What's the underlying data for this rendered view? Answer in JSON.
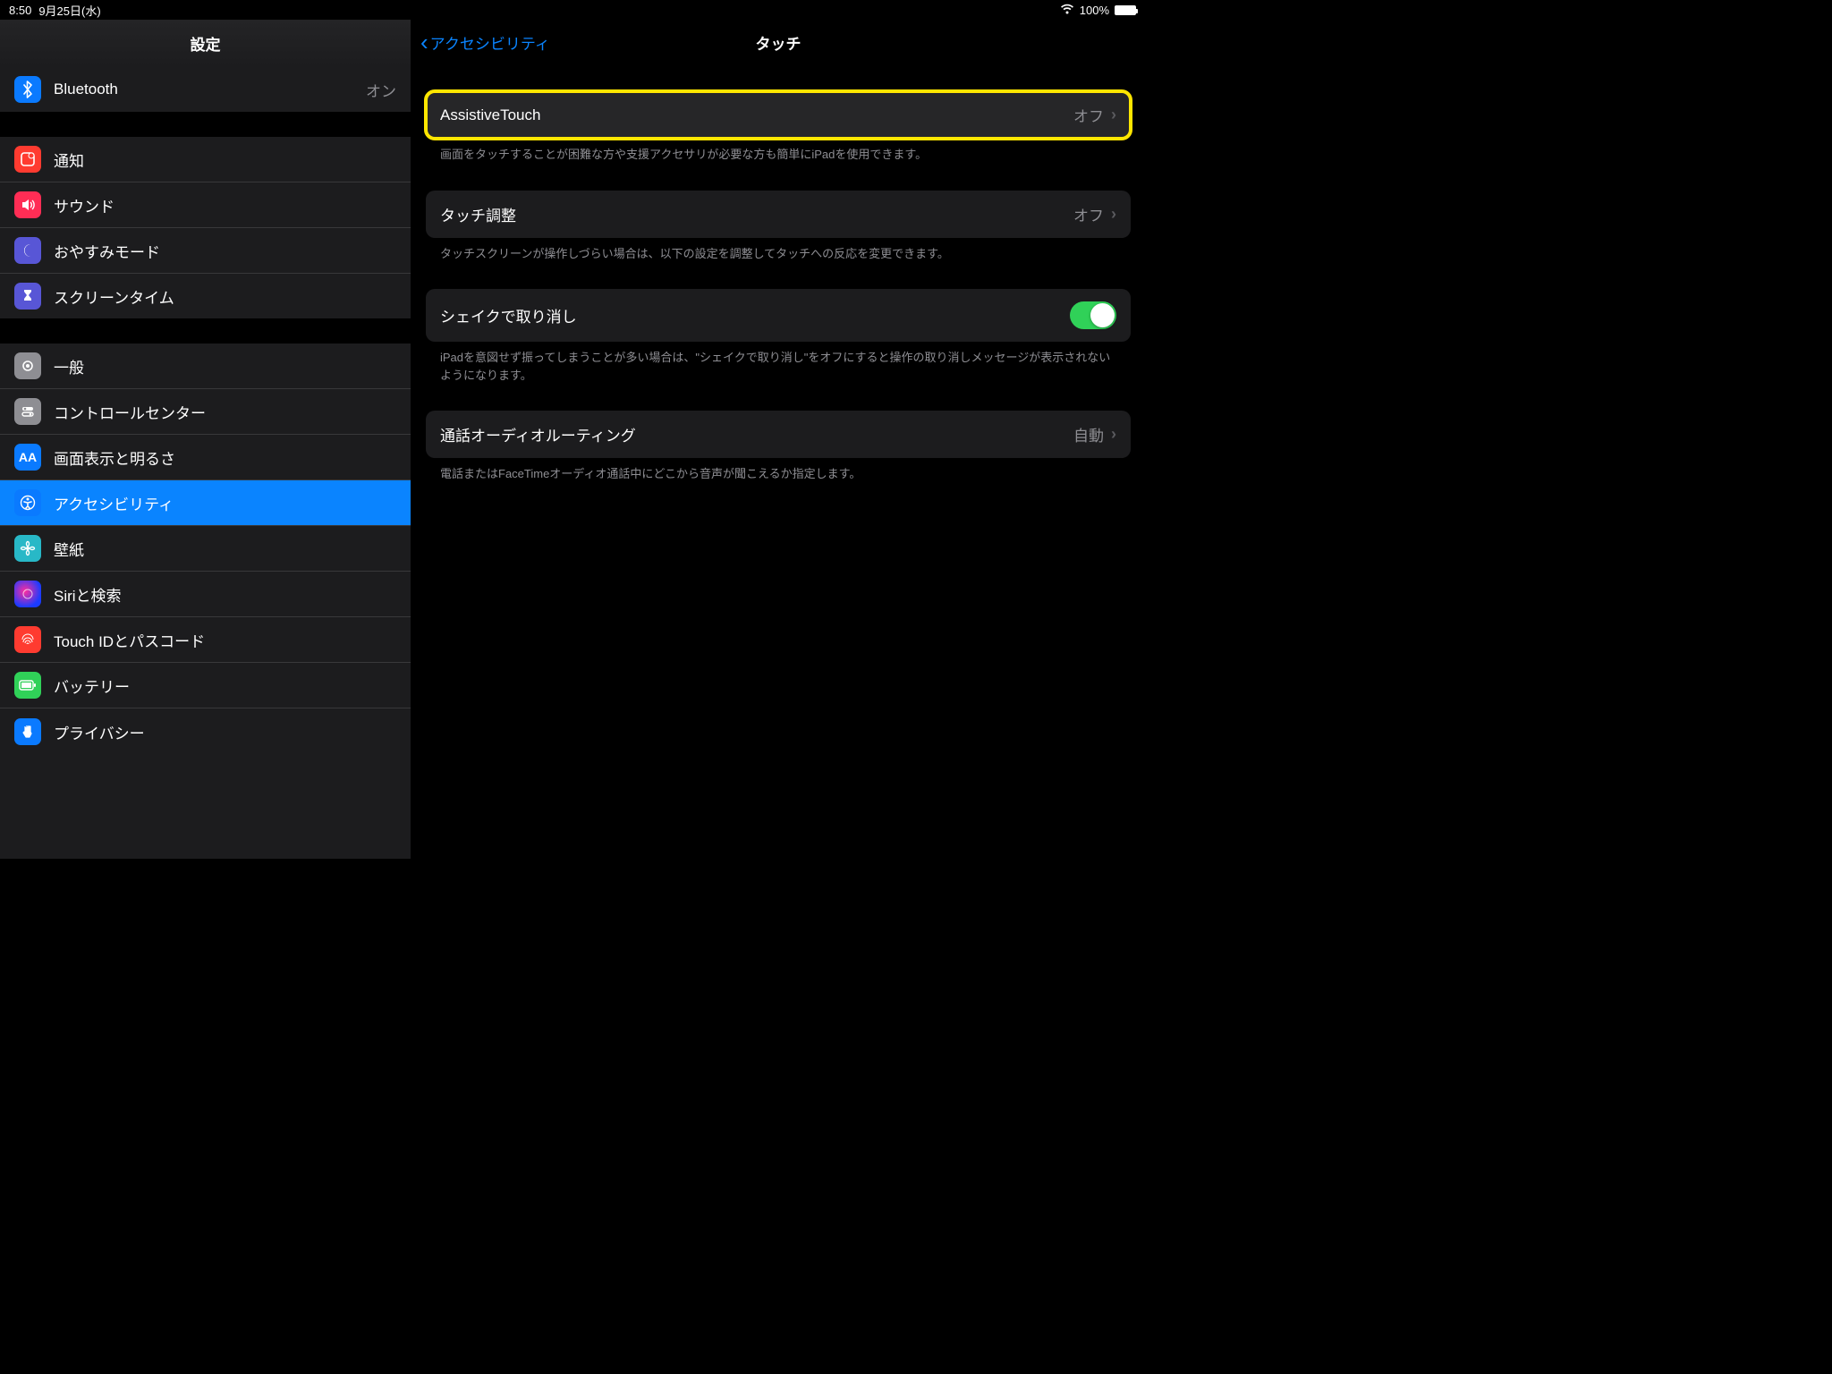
{
  "status": {
    "time": "8:50",
    "date": "9月25日(水)",
    "battery": "100%"
  },
  "sidebar": {
    "title": "設定",
    "bluetoothLabel": "Bluetooth",
    "bluetoothValue": "オン",
    "notifications": "通知",
    "sound": "サウンド",
    "dnd": "おやすみモード",
    "screentime": "スクリーンタイム",
    "general": "一般",
    "controlcenter": "コントロールセンター",
    "display": "画面表示と明るさ",
    "accessibility": "アクセシビリティ",
    "wallpaper": "壁紙",
    "siri": "Siriと検索",
    "touchid": "Touch IDとパスコード",
    "battery": "バッテリー",
    "privacy": "プライバシー"
  },
  "detail": {
    "backLabel": "アクセシビリティ",
    "title": "タッチ",
    "rows": {
      "assistive": {
        "label": "AssistiveTouch",
        "value": "オフ"
      },
      "assistiveFooter": "画面をタッチすることが困難な方や支援アクセサリが必要な方も簡単にiPadを使用できます。",
      "touchAdj": {
        "label": "タッチ調整",
        "value": "オフ"
      },
      "touchAdjFooter": "タッチスクリーンが操作しづらい場合は、以下の設定を調整してタッチへの反応を変更できます。",
      "shake": {
        "label": "シェイクで取り消し"
      },
      "shakeFooter": "iPadを意図せず振ってしまうことが多い場合は、\"シェイクで取り消し\"をオフにすると操作の取り消しメッセージが表示されないようになります。",
      "audio": {
        "label": "通話オーディオルーティング",
        "value": "自動"
      },
      "audioFooter": "電話またはFaceTimeオーディオ通話中にどこから音声が聞こえるか指定します。"
    }
  }
}
